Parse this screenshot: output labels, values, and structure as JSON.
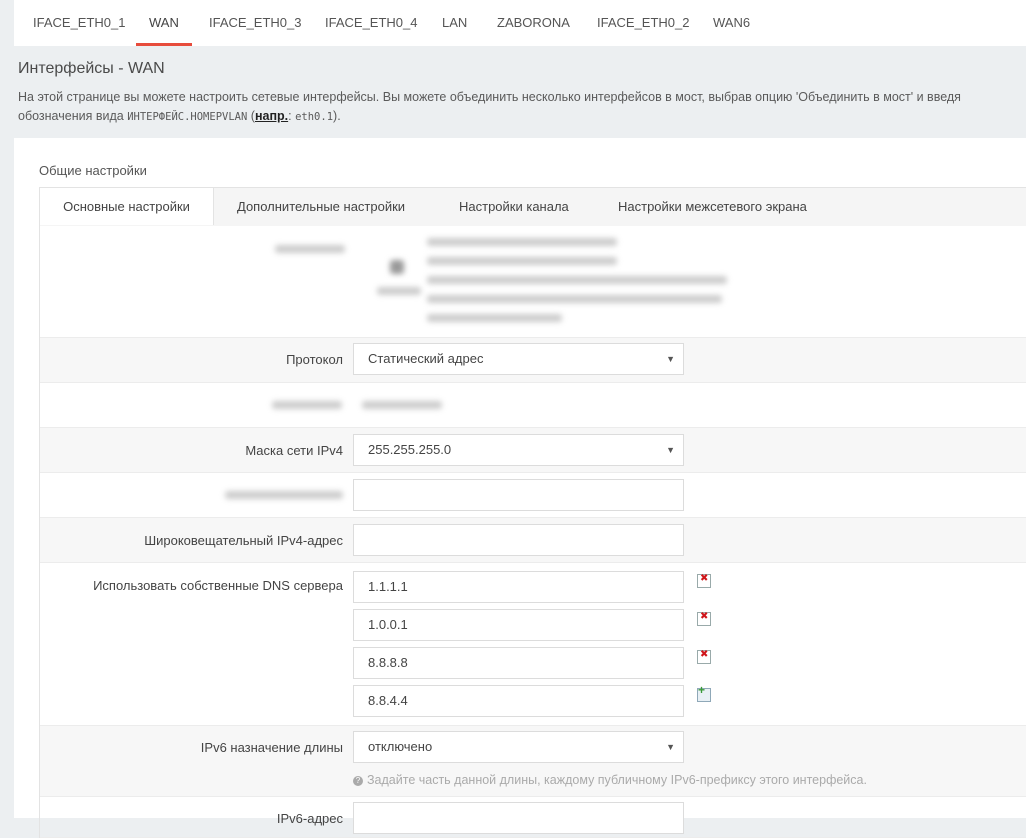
{
  "tabs": [
    "IFACE_ETH0_1",
    "WAN",
    "IFACE_ETH0_3",
    "IFACE_ETH0_4",
    "LAN",
    "ZABORONA",
    "IFACE_ETH0_2",
    "WAN6"
  ],
  "active_tab": "WAN",
  "page": {
    "title": "Интерфейсы - WAN",
    "desc_line1": "На этой странице вы можете настроить сетевые интерфейсы. Вы можете объединить несколько интерфейсов в мост, выбрав опцию 'Объединить в мост' и введя",
    "desc_line2_prefix": "обозначения вида",
    "desc_line2_code": "ИНТЕРФЕЙС.HOMEPVLAN",
    "desc_line2_mid": "(",
    "desc_line2_link": "напр.",
    "desc_line2_colon": ":",
    "desc_line2_code2": "eth0.1",
    "desc_line2_end": ")."
  },
  "section": {
    "title": "Общие настройки",
    "subtabs": [
      "Основные настройки",
      "Дополнительные настройки",
      "Настройки канала",
      "Настройки межсетевого экрана"
    ]
  },
  "form": {
    "protocol_label": "Протокол",
    "protocol_value": "Статический адрес",
    "netmask_label": "Маска сети IPv4",
    "netmask_value": "255.255.255.0",
    "broadcast_label": "Широковещательный IPv4-адрес",
    "broadcast_value": "",
    "dns_label": "Использовать собственные DNS сервера",
    "dns_servers": [
      "1.1.1.1",
      "1.0.0.1",
      "8.8.8.8",
      "8.8.4.4"
    ],
    "ipv6_label": "IPv6 назначение длины",
    "ipv6_value": "отключено",
    "ipv6_hint": "Задайте часть данной длины, каждому публичному IPv6-префиксу этого интерфейса.",
    "ipv6_addr_label": "IPv6-адрес"
  }
}
